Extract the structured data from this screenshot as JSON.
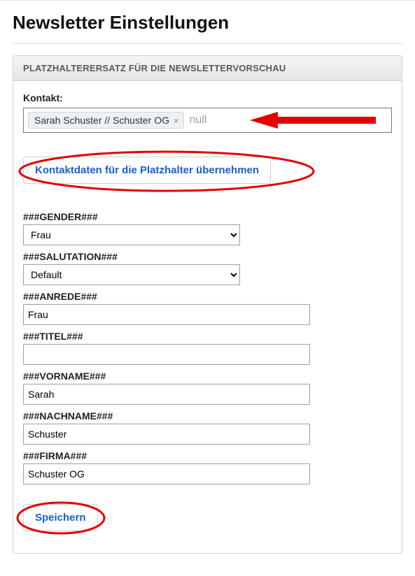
{
  "page": {
    "title": "Newsletter Einstellungen"
  },
  "panel": {
    "header": "PLATZHALTERERSATZ FÜR DIE NEWSLETTERVORSCHAU"
  },
  "contact": {
    "label": "Kontakt:",
    "tag": "Sarah Schuster // Schuster OG",
    "placeholder": "null"
  },
  "apply_button": "Kontaktdaten für die Platzhalter übernehmen",
  "fields": {
    "gender": {
      "label": "###GENDER###",
      "value": "Frau"
    },
    "salutation": {
      "label": "###SALUTATION###",
      "value": "Default"
    },
    "anrede": {
      "label": "###ANREDE###",
      "value": "Frau"
    },
    "titel": {
      "label": "###TITEL###",
      "value": ""
    },
    "vorname": {
      "label": "###VORNAME###",
      "value": "Sarah"
    },
    "nachname": {
      "label": "###NACHNAME###",
      "value": "Schuster"
    },
    "firma": {
      "label": "###FIRMA###",
      "value": "Schuster OG"
    }
  },
  "save_button": "Speichern"
}
